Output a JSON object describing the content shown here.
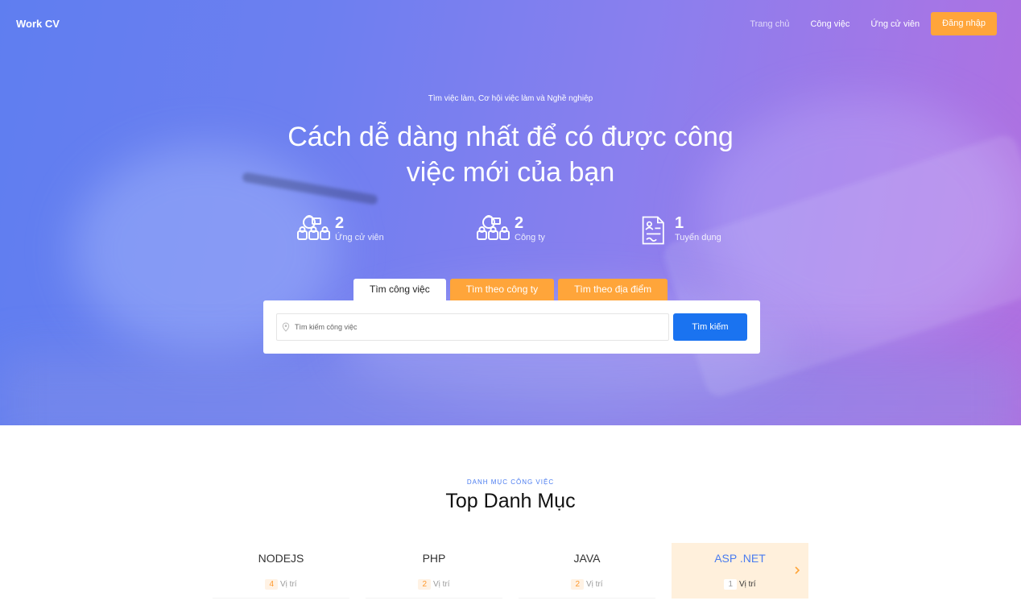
{
  "nav": {
    "logo": "Work CV",
    "items": [
      {
        "label": "Trang chủ"
      },
      {
        "label": "Công việc"
      },
      {
        "label": "Ứng cử viên"
      }
    ],
    "login_label": "Đăng nhập"
  },
  "hero": {
    "tagline": "Tìm việc làm, Cơ hội việc làm và Nghề nghiệp",
    "headline": "Cách dễ dàng nhất để có được công việc mới của bạn",
    "stats": [
      {
        "value": "2",
        "label": "Ứng cử viên",
        "icon": "candidates-icon"
      },
      {
        "value": "2",
        "label": "Công ty",
        "icon": "companies-icon"
      },
      {
        "value": "1",
        "label": "Tuyển dụng",
        "icon": "resume-icon"
      }
    ]
  },
  "search": {
    "tabs": [
      {
        "label": "Tìm công việc",
        "active": true
      },
      {
        "label": "Tìm theo công ty",
        "active": false
      },
      {
        "label": "Tìm theo địa điểm",
        "active": false
      }
    ],
    "placeholder": "Tìm kiếm công việc",
    "button_label": "Tìm kiếm"
  },
  "categories": {
    "kicker": "DANH MỤC CÔNG VIỆC",
    "title": "Top Danh Mục",
    "items": [
      {
        "name": "NODEJS",
        "count": "4",
        "unit": "Vị trí"
      },
      {
        "name": "PHP",
        "count": "2",
        "unit": "Vị trí"
      },
      {
        "name": "JAVA",
        "count": "2",
        "unit": "Vị trí"
      },
      {
        "name": "ASP .NET",
        "count": "1",
        "unit": "Vị trí"
      }
    ]
  },
  "colors": {
    "accent_orange": "#ffa53a",
    "primary_blue": "#1a73f0",
    "hero_gradient_start": "#5f7ef0",
    "hero_gradient_end": "#b06fe0"
  }
}
